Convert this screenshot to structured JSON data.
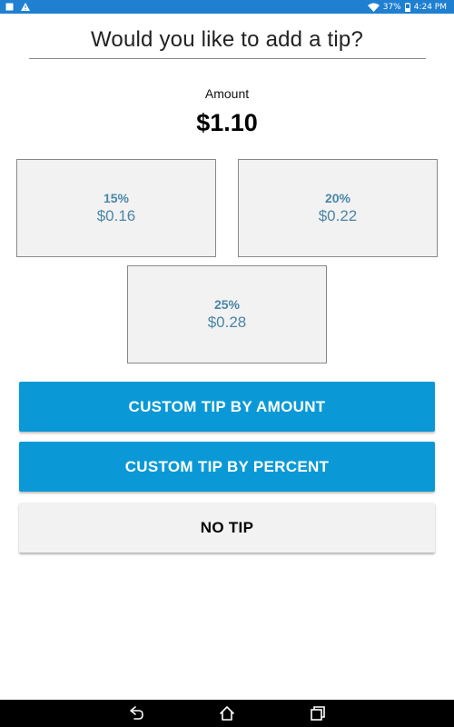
{
  "status_bar": {
    "battery": "37%",
    "time": "4:24 PM",
    "background_color": "#1f7fd0"
  },
  "header": {
    "title": "Would you like to add a tip?"
  },
  "amount": {
    "label": "Amount",
    "value": "$1.10"
  },
  "tip_options": [
    {
      "percent": "15%",
      "amount": "$0.16"
    },
    {
      "percent": "20%",
      "amount": "$0.22"
    },
    {
      "percent": "25%",
      "amount": "$0.28"
    }
  ],
  "buttons": {
    "custom_amount": "CUSTOM TIP BY AMOUNT",
    "custom_percent": "CUSTOM TIP BY PERCENT",
    "no_tip": "NO TIP"
  },
  "colors": {
    "accent_blue": "#0a99d6",
    "tip_text": "#4a86a8",
    "card_background": "#f2f2f2"
  },
  "nav_icons": [
    "back-icon",
    "home-icon",
    "recent-apps-icon"
  ]
}
